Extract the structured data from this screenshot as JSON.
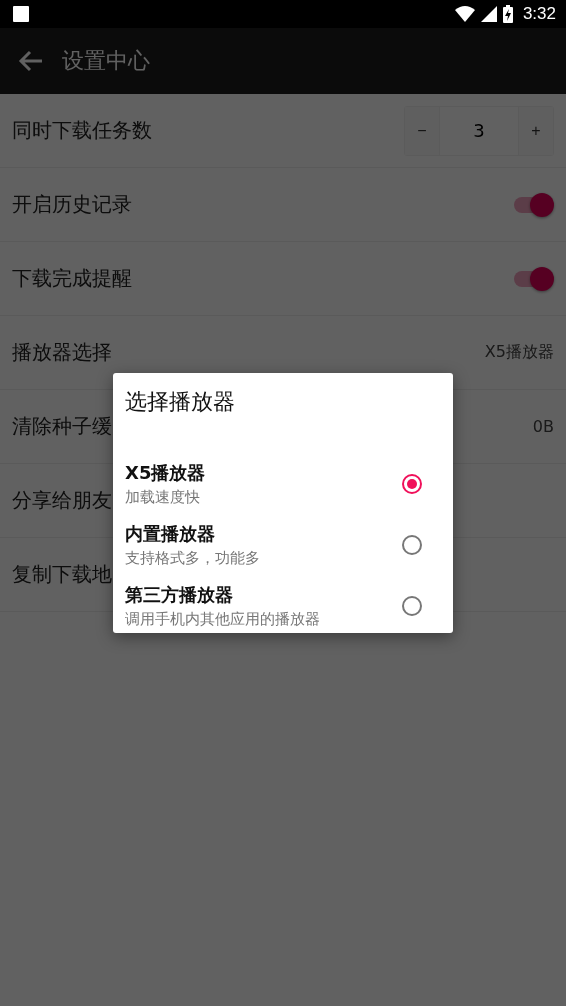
{
  "status_bar": {
    "time": "3:32"
  },
  "app_bar": {
    "title": "设置中心"
  },
  "settings": [
    {
      "kind": "stepper",
      "label": "同时下载任务数",
      "minus": "−",
      "value": "3",
      "plus": "+"
    },
    {
      "kind": "toggle",
      "label": "开启历史记录",
      "on": true
    },
    {
      "kind": "toggle",
      "label": "下载完成提醒",
      "on": true
    },
    {
      "kind": "value",
      "label": "播放器选择",
      "value": "X5播放器"
    },
    {
      "kind": "value",
      "label": "清除种子缓",
      "value": "0B"
    },
    {
      "kind": "plain",
      "label": "分享给朋友"
    },
    {
      "kind": "plain",
      "label": "复制下载地"
    }
  ],
  "dialog": {
    "title": "选择播放器",
    "options": [
      {
        "title": "X5播放器",
        "subtitle": "加载速度快",
        "selected": true
      },
      {
        "title": "内置播放器",
        "subtitle": "支持格式多，功能多",
        "selected": false
      },
      {
        "title": "第三方播放器",
        "subtitle": "调用手机内其他应用的播放器",
        "selected": false
      }
    ]
  }
}
